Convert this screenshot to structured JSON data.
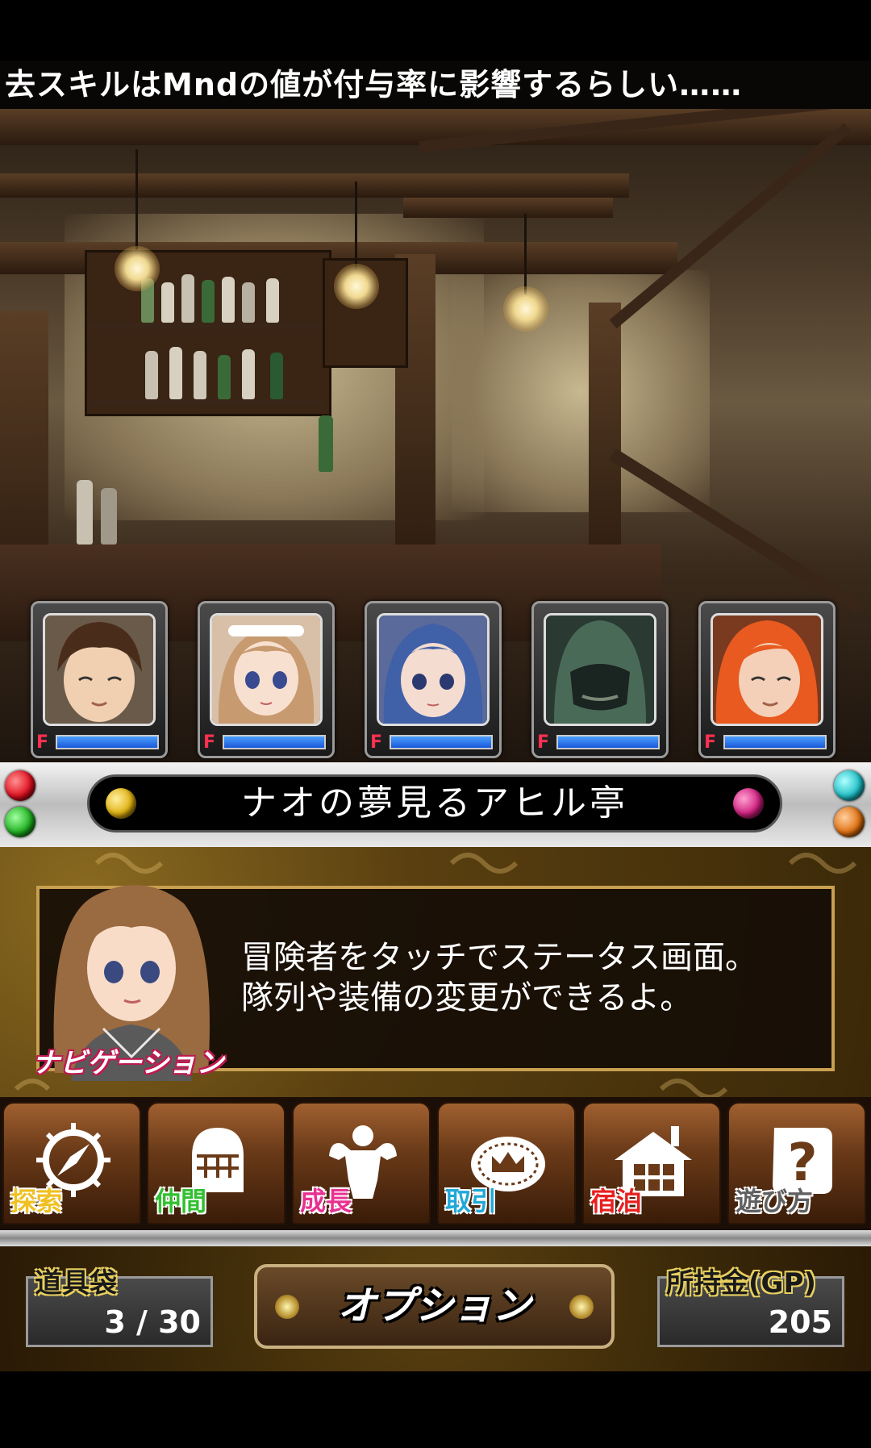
{
  "ticker": {
    "text": "去スキルはMndの値が付与率に影響するらしい……"
  },
  "party": [
    {
      "name": "member-1",
      "status_mark": "F",
      "hp_fraction": 1.0,
      "hair": "#4a2c1a",
      "skin": "#f0d0b0"
    },
    {
      "name": "member-2",
      "status_mark": "F",
      "hp_fraction": 1.0,
      "hair": "#c89a70",
      "skin": "#f8e0d0"
    },
    {
      "name": "member-3",
      "status_mark": "F",
      "hp_fraction": 1.0,
      "hair": "#4060a8",
      "skin": "#f4dcd0"
    },
    {
      "name": "member-4",
      "status_mark": "F",
      "hp_fraction": 1.0,
      "hair": "#4a6a58",
      "skin": "#7a8878"
    },
    {
      "name": "member-5",
      "status_mark": "F",
      "hp_fraction": 1.0,
      "hair": "#e85a20",
      "skin": "#f4d0b8"
    }
  ],
  "location": {
    "name": "ナオの夢見るアヒル亭"
  },
  "navigation": {
    "label": "ナビゲーション",
    "message_line1": "冒険者をタッチでステータス画面。",
    "message_line2": "隊列や装備の変更ができるよ。"
  },
  "commands": [
    {
      "label": "探索",
      "icon": "compass-icon",
      "color": "#f0c020"
    },
    {
      "label": "仲間",
      "icon": "knight-helmet-icon",
      "color": "#30c030"
    },
    {
      "label": "成長",
      "icon": "muscle-icon",
      "color": "#e83090"
    },
    {
      "label": "取引",
      "icon": "crown-coin-icon",
      "color": "#20a8d8"
    },
    {
      "label": "宿泊",
      "icon": "inn-house-icon",
      "color": "#e82020"
    },
    {
      "label": "遊び方",
      "icon": "question-scroll-icon",
      "color": "#606060"
    }
  ],
  "inventory": {
    "label": "道具袋",
    "value": "3 / 30"
  },
  "options": {
    "label": "オプション"
  },
  "gold": {
    "label": "所持金(GP)",
    "value": "205"
  },
  "colors": {
    "hp_bar": "#2a70f0",
    "accent_gold": "#c8a050",
    "gem_red": "#e01020",
    "gem_green": "#20b020",
    "gem_yellow": "#e0b010",
    "gem_pink": "#d02080",
    "gem_cyan": "#20c0c8",
    "gem_orange": "#e07010"
  }
}
